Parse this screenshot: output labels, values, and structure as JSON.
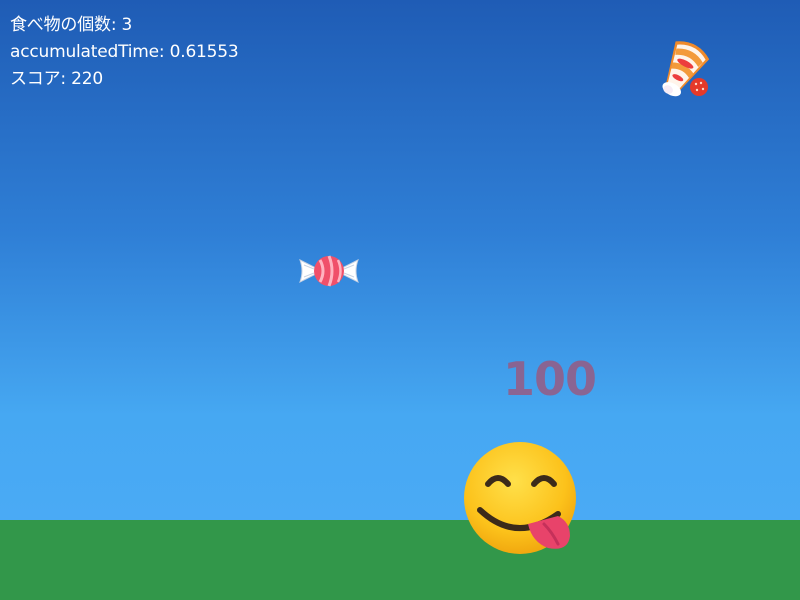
{
  "hud": {
    "food_count_label": "食べ物の個数",
    "food_count_value": "3",
    "accumulated_time_label": "accumulatedTime",
    "accumulated_time_value": "0.61553",
    "score_label": "スコア",
    "score_value": "220"
  },
  "score_popup": "100",
  "sprites": {
    "falling_foods": [
      "shortcake-slice-icon",
      "candy-icon"
    ],
    "player": "face-savoring-food-emoji"
  },
  "colors": {
    "sky_top": "#1f5cb5",
    "sky_bottom": "#4aaaf5",
    "ground": "#32974a",
    "hud_text": "#ffffff",
    "popup_text": "#965a82"
  }
}
